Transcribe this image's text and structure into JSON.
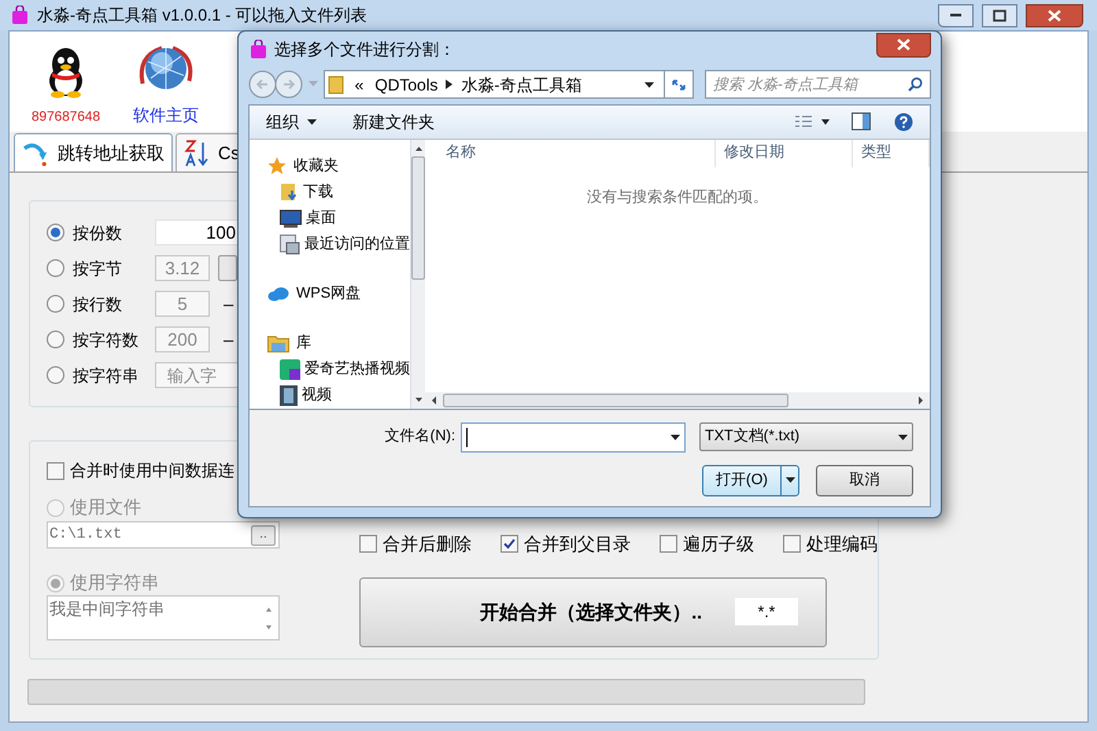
{
  "window": {
    "title": "水淼-奇点工具箱 v1.0.0.1 - 可以拖入文件列表"
  },
  "header": {
    "qq_label": "897687648",
    "homepage_link": "软件主页"
  },
  "tabs": [
    {
      "label": "跳转地址获取",
      "selected": true
    },
    {
      "label": "Cs",
      "selected": false
    }
  ],
  "split_panel": {
    "options": [
      {
        "label": "按份数",
        "selected": true,
        "kind": "field",
        "value": "100"
      },
      {
        "label": "按字节",
        "selected": false,
        "kind": "field_with_button",
        "value": "3.12"
      },
      {
        "label": "按行数",
        "selected": false,
        "kind": "field",
        "value": "5",
        "suffix": "–"
      },
      {
        "label": "按字符数",
        "selected": false,
        "kind": "field",
        "value": "200",
        "suffix": "–"
      },
      {
        "label": "按字符串",
        "selected": false,
        "kind": "text",
        "placeholder": "输入字"
      }
    ]
  },
  "merge_panel": {
    "use_middle_data": {
      "label": "合并时使用中间数据连",
      "checked": false
    },
    "sources": [
      {
        "label": "使用文件",
        "selected": false,
        "disabled": true,
        "kind": "file",
        "value": "C:\\1.txt",
        "button": ".."
      },
      {
        "label": "使用字符串",
        "selected": true,
        "disabled": true,
        "kind": "text",
        "value": "我是中间字符串"
      }
    ],
    "options": [
      {
        "label": "合并后删除",
        "checked": false
      },
      {
        "label": "合并到父目录",
        "checked": true
      },
      {
        "label": "遍历子级",
        "checked": false
      },
      {
        "label": "处理编码",
        "checked": false
      }
    ],
    "start_button": "开始合并（选择文件夹）..",
    "pattern": "*.*"
  },
  "progress": {
    "level": 0
  },
  "dialog": {
    "title": "选择多个文件进行分割：",
    "breadcrumb": {
      "overflow": "«",
      "parts": [
        "QDTools",
        "水淼-奇点工具箱"
      ]
    },
    "search": {
      "placeholder": "搜索 水淼-奇点工具箱"
    },
    "toolbar": [
      {
        "label": "组织",
        "kind": "menu"
      },
      {
        "label": "新建文件夹",
        "kind": "button"
      }
    ],
    "nav_pane": [
      {
        "label": "收藏夹",
        "children": [
          {
            "label": "下载"
          },
          {
            "label": "桌面"
          },
          {
            "label": "最近访问的位置"
          }
        ]
      },
      {
        "label": "WPS网盘"
      },
      {
        "label": "库",
        "children": [
          {
            "label": "爱奇艺热播视频"
          },
          {
            "label": "视频"
          }
        ]
      }
    ],
    "columns": [
      "名称",
      "修改日期",
      "类型"
    ],
    "empty_message": "没有与搜索条件匹配的项。",
    "filename_label": "文件名(N):",
    "file_type": "TXT文档(*.txt)",
    "open_button": "打开(O)",
    "cancel_button": "取消"
  }
}
